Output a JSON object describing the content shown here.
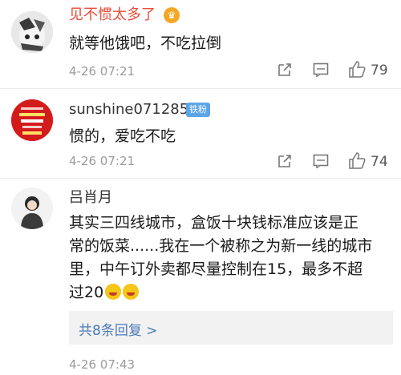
{
  "comments": [
    {
      "username": "见不惯太多了",
      "text": "就等他饿吧，不吃拉倒",
      "timestamp": "4-26 07:21",
      "likes": "79",
      "username_color": "#e74c3c",
      "avatar_desc": "avatar-photo"
    },
    {
      "username": "sunshine071285",
      "badge": "铁粉",
      "text": "惯的，爱吃不吃",
      "timestamp": "4-26 07:21",
      "likes": "74",
      "username_color": "#333333",
      "avatar_desc": "avatar-red-logo"
    },
    {
      "username": "吕肖月",
      "text_lines": [
        "其实三四线城市，盒饭十块钱标准应该是正",
        "常的饭菜......我在一个被称之为新一线的城市",
        "里，中午订外卖都尽量控制在15，最多不超",
        "过20"
      ],
      "replies_label": "共8条回复 >",
      "timestamp": "4-26 07:43",
      "username_color": "#333333",
      "avatar_desc": "avatar-person"
    }
  ],
  "icons": [
    "share-icon",
    "comment-icon",
    "like-icon"
  ],
  "colors": {
    "link": "#4a7ab8",
    "meta": "#9b9b9b",
    "separator": "#ededed"
  }
}
